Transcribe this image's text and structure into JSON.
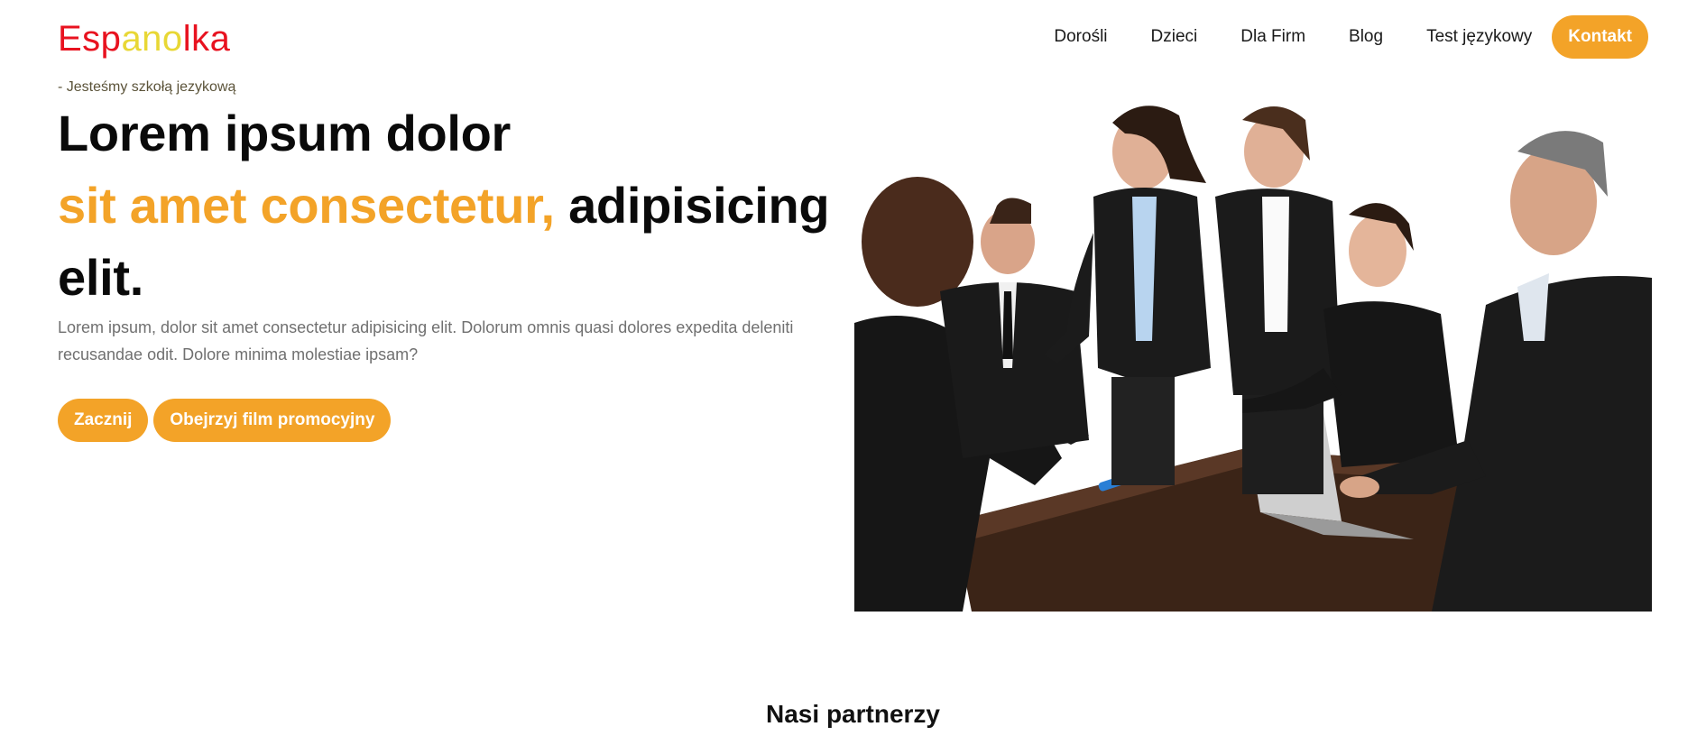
{
  "logo": {
    "segments": [
      "Esp",
      "ano",
      "lka"
    ],
    "colors": {
      "primary": "#e8121f",
      "accent": "#e8d735"
    }
  },
  "nav": {
    "items": [
      "Dorośli",
      "Dzieci",
      "Dla Firm",
      "Blog",
      "Test językowy"
    ],
    "cta": "Kontakt"
  },
  "hero": {
    "tagline": "- Jesteśmy szkołą jezykową",
    "headline_line1": "Lorem ipsum dolor",
    "headline_highlight": "sit amet consectetur,",
    "headline_rest": "adipisicing elit.",
    "lead": "Lorem ipsum, dolor sit amet consectetur adipisicing elit. Dolorum omnis quasi dolores expedita deleniti recusandae odit. Dolore minima molestiae ipsam?",
    "primary_button": "Zacznij",
    "secondary_button": "Obejrzyj film promocyjny"
  },
  "partners": {
    "title": "Nasi partnerzy"
  },
  "theme": {
    "accent": "#f3a328",
    "text": "#0a0a0a",
    "muted": "#707070"
  }
}
